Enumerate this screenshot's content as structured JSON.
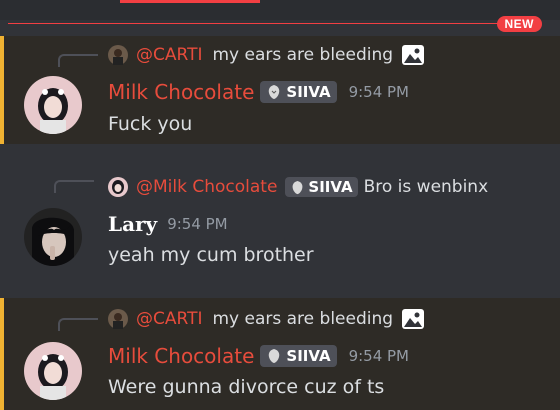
{
  "divider": {
    "badge": "NEW"
  },
  "messages": [
    {
      "reply": {
        "author": "@CARTI",
        "text": "my ears are bleeding",
        "has_image": true
      },
      "author": "Milk Chocolate",
      "tag": "SIIVA",
      "time": "9:54 PM",
      "content": "Fuck you"
    },
    {
      "reply": {
        "author": "@Milk Chocolate",
        "tag": "SIIVA",
        "text": "Bro is wenbinx"
      },
      "author": "Lary",
      "time": "9:54 PM",
      "content": "yeah my cum brother"
    },
    {
      "reply": {
        "author": "@CARTI",
        "text": "my ears are bleeding",
        "has_image": true
      },
      "author": "Milk Chocolate",
      "tag": "SIIVA",
      "time": "9:54 PM",
      "content": "Were gunna divorce cuz of ts"
    }
  ],
  "icons": {
    "tag_icon": "lion-head-icon",
    "image_icon": "image-icon"
  },
  "colors": {
    "mention_bg": "#2e2b26",
    "mention_bar": "#f0b232",
    "author_red": "#e74c3c",
    "new_red": "#f23f43"
  }
}
